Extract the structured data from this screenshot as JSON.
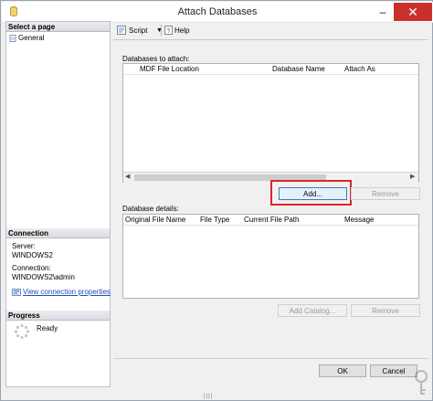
{
  "window": {
    "title": "Attach Databases"
  },
  "left_pane": {
    "select_page_header": "Select a page",
    "pages": [
      {
        "label": "General"
      }
    ],
    "connection_header": "Connection",
    "server_label": "Server:",
    "server_value": "WINDOWS2",
    "connection_label": "Connection:",
    "connection_value": "WINDOWS2\\admin",
    "view_connection_link": "View connection properties",
    "progress_header": "Progress",
    "progress_status": "Ready"
  },
  "toolbar": {
    "script_label": "Script",
    "help_label": "Help"
  },
  "attach_section": {
    "label": "Databases to attach:",
    "columns": [
      "MDF File Location",
      "Database Name",
      "Attach As"
    ],
    "add_button": "Add...",
    "remove_button": "Remove"
  },
  "details_section": {
    "label": "Database details:",
    "columns": [
      "Original File Name",
      "File Type",
      "Current File Path",
      "Message"
    ],
    "add_catalog_button": "Add Catalog...",
    "remove_button": "Remove"
  },
  "footer": {
    "ok_button": "OK",
    "cancel_button": "Cancel"
  },
  "colors": {
    "highlight_border": "#d9262b",
    "link": "#1f4fb5",
    "close_button": "#c9302c"
  },
  "icons": [
    "database-app-icon",
    "page-icon",
    "connection-properties-icon",
    "spinner-icon",
    "script-icon",
    "help-icon"
  ]
}
